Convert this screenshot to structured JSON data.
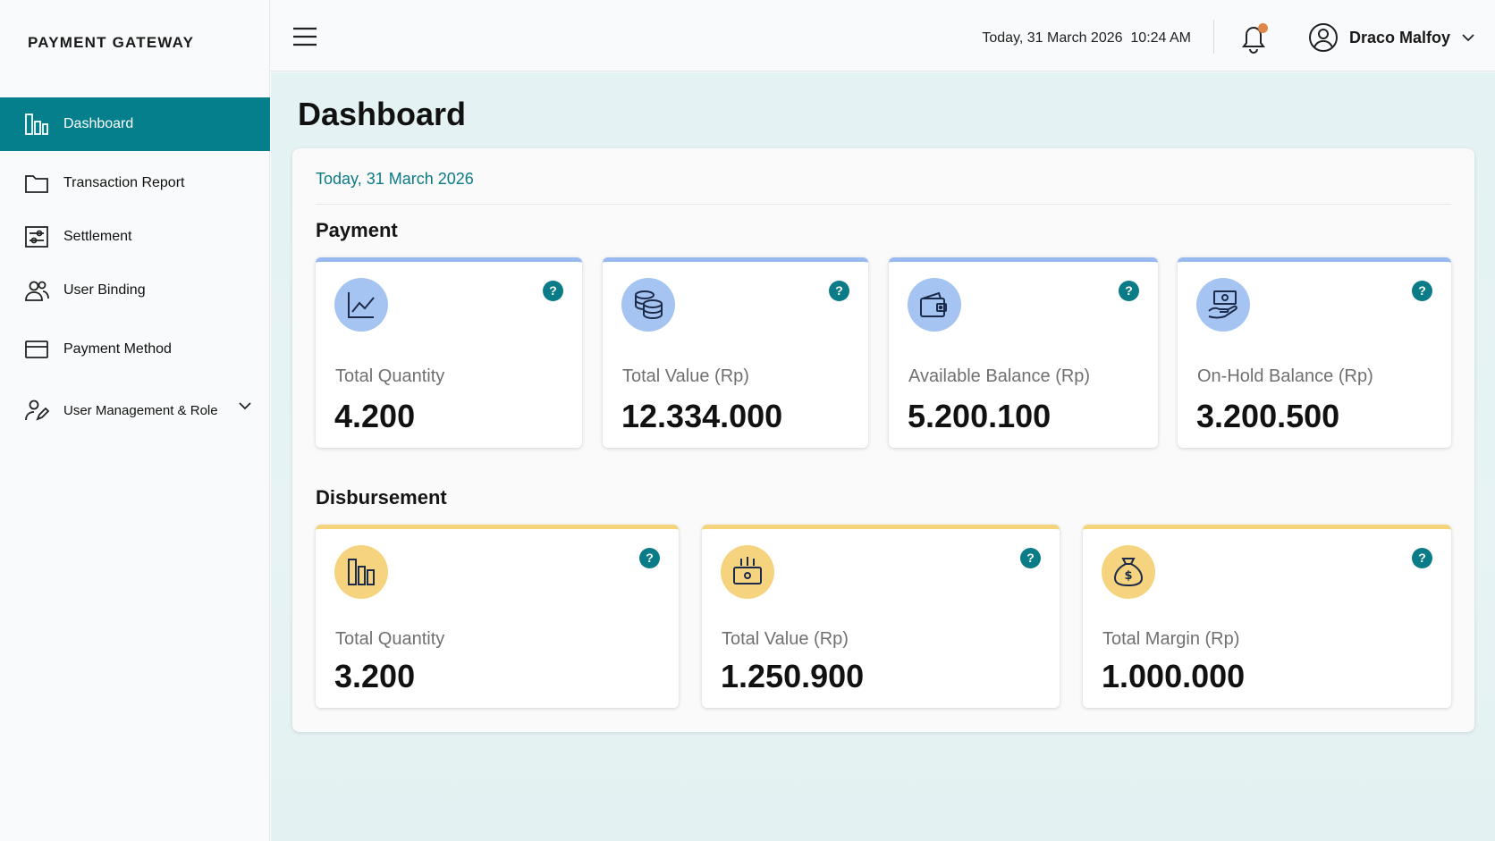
{
  "brand": "PAYMENT GATEWAY",
  "sidebar": {
    "items": [
      {
        "label": "Dashboard",
        "icon": "bar-chart-icon",
        "active": true
      },
      {
        "label": "Transaction Report",
        "icon": "folder-icon"
      },
      {
        "label": "Settlement",
        "icon": "sliders-icon"
      },
      {
        "label": "User Binding",
        "icon": "users-icon"
      },
      {
        "label": "Payment Method",
        "icon": "credit-card-icon"
      },
      {
        "label": "User Management & Role",
        "icon": "user-edit-icon",
        "expandable": true
      }
    ]
  },
  "header": {
    "datetime": "Today, 31 March 2026  10:24 AM",
    "notification_dot_color": "#e0874a",
    "user_name": "Draco Malfoy"
  },
  "main": {
    "title": "Dashboard",
    "date_label": "Today, 31 March 2026",
    "payment": {
      "title": "Payment",
      "cards": [
        {
          "label": "Total Quantity",
          "value": "4.200",
          "icon": "line-chart-icon"
        },
        {
          "label": "Total Value (Rp)",
          "value": "12.334.000",
          "icon": "coins-stack-icon"
        },
        {
          "label": "Available Balance (Rp)",
          "value": "5.200.100",
          "icon": "wallet-icon"
        },
        {
          "label": "On-Hold Balance (Rp)",
          "value": "3.200.500",
          "icon": "hand-money-icon"
        }
      ]
    },
    "disbursement": {
      "title": "Disbursement",
      "cards": [
        {
          "label": "Total Quantity",
          "value": "3.200",
          "icon": "bar-chart-icon"
        },
        {
          "label": "Total Value (Rp)",
          "value": "1.250.900",
          "icon": "cash-register-icon"
        },
        {
          "label": "Total Margin (Rp)",
          "value": "1.000.000",
          "icon": "money-bag-icon"
        }
      ]
    },
    "help_glyph": "?"
  },
  "colors": {
    "accent": "#067f8c",
    "payment_card_top": "#98baf0",
    "disbursement_card_top": "#f3d47a"
  }
}
